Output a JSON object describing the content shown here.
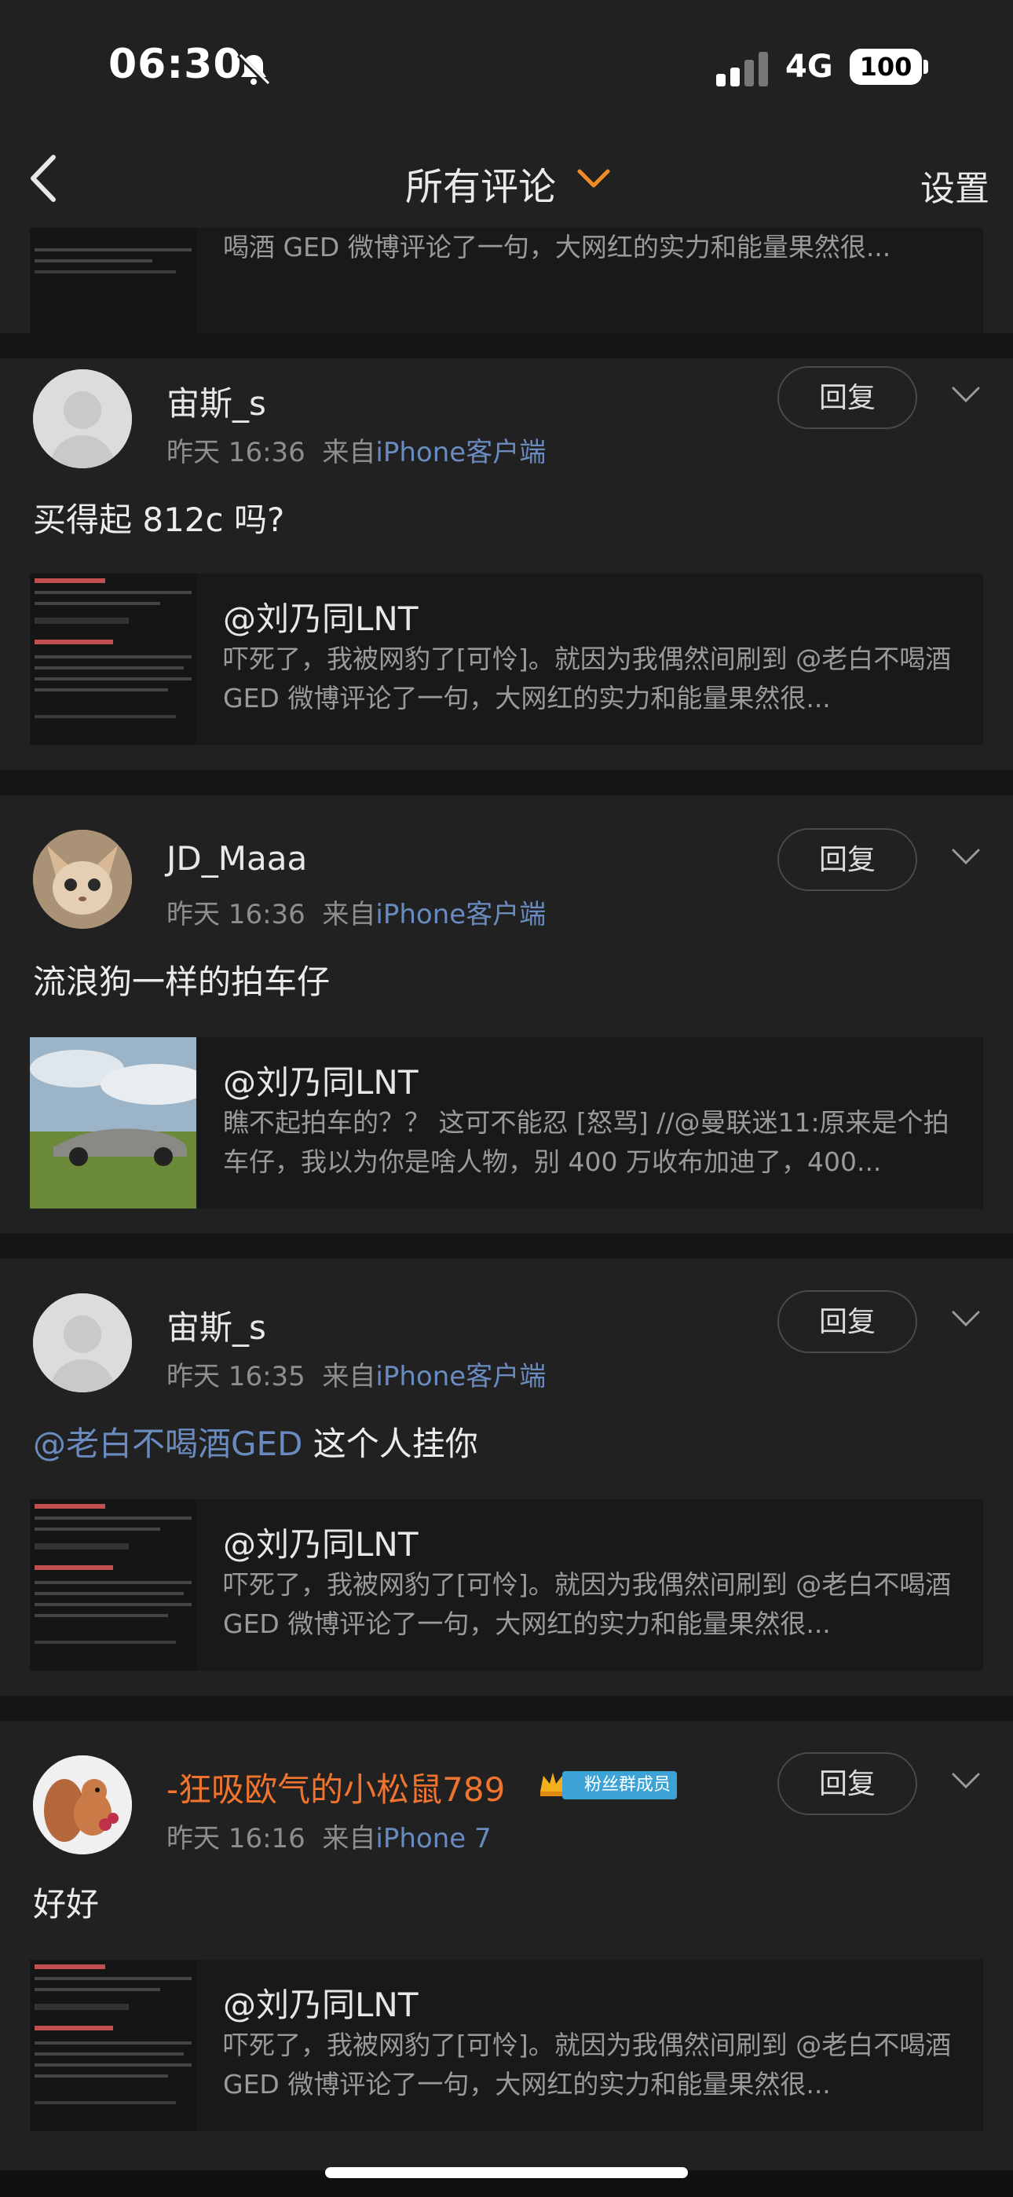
{
  "status": {
    "time": "06:30",
    "network": "4G",
    "battery": "100"
  },
  "nav": {
    "title": "所有评论",
    "settings": "设置"
  },
  "quotes": {
    "prev_text": "喝酒 GED 微博评论了一句，大网红的实力和能量果然很...",
    "author": "@刘乃同LNT",
    "text_a": "吓死了，我被网豹了[可怜]。就因为我偶然间刷到 @老白不喝酒 GED 微博评论了一句，大网红的实力和能量果然很...",
    "text_b": "瞧不起拍车的？？ 这可不能忍 [怒骂] //@曼联迷11:原来是个拍车仔，我以为你是啥人物，别 400 万收布加迪了，400..."
  },
  "comments": [
    {
      "user": "宙斯_s",
      "time": "昨天 16:36",
      "from": "来自",
      "source": "iPhone客户端",
      "text": "买得起 812c 吗?",
      "reply": "回复"
    },
    {
      "user": "JD_Maaa",
      "time": "昨天 16:36",
      "from": "来自",
      "source": "iPhone客户端",
      "text": "流浪狗一样的拍车仔",
      "reply": "回复"
    },
    {
      "user": "宙斯_s",
      "time": "昨天 16:35",
      "from": "来自",
      "source": "iPhone客户端",
      "mention": "@老白不喝酒GED",
      "text": " 这个人挂你",
      "reply": "回复"
    },
    {
      "user": "-狂吸欧气的小松鼠789",
      "badge": "粉丝群成员",
      "time": "昨天 16:16",
      "from": "来自",
      "source": "iPhone 7",
      "text": "好好",
      "reply": "回复"
    }
  ],
  "colors": {
    "card": "#212121",
    "divider": "#151515",
    "link": "#6a8bc0",
    "vip_name": "#f0742d",
    "badge": "#3da3d6"
  }
}
